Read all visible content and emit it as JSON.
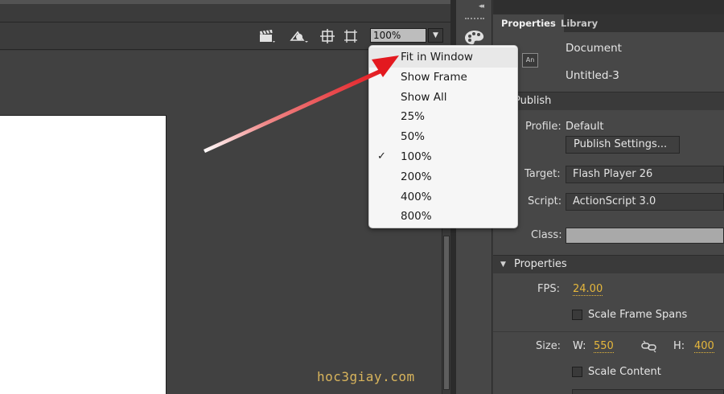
{
  "stage": {
    "zoom_value": "100%",
    "watermark": "hoc3giay.com"
  },
  "zoom_menu": {
    "items": [
      {
        "label": "Fit in Window",
        "checked": false,
        "hover": true
      },
      {
        "label": "Show Frame",
        "checked": false
      },
      {
        "label": "Show All",
        "checked": false
      },
      {
        "label": "25%",
        "checked": false
      },
      {
        "label": "50%",
        "checked": false
      },
      {
        "label": "100%",
        "checked": true
      },
      {
        "label": "200%",
        "checked": false
      },
      {
        "label": "400%",
        "checked": false
      },
      {
        "label": "800%",
        "checked": false
      }
    ]
  },
  "panel": {
    "tabs": [
      "Properties",
      "Library"
    ],
    "doc_icon": "An",
    "doc_type": "Document",
    "doc_name": "Untitled-3",
    "publish": {
      "title": "Publish",
      "profile_label": "Profile:",
      "profile_value": "Default",
      "publish_settings_button": "Publish Settings...",
      "target_label": "Target:",
      "target_value": "Flash Player 26",
      "script_label": "Script:",
      "script_value": "ActionScript 3.0",
      "class_label": "Class:"
    },
    "properties": {
      "title": "Properties",
      "fps_label": "FPS:",
      "fps_value": "24.00",
      "scale_frame_spans": "Scale Frame Spans",
      "size_label": "Size:",
      "w_label": "W:",
      "w_value": "550",
      "h_label": "H:",
      "h_value": "400",
      "scale_content": "Scale Content"
    }
  },
  "colors": {
    "accent_hot": "#e6b73c",
    "arrow": "#e3191f",
    "watermark": "#d8b45c"
  }
}
